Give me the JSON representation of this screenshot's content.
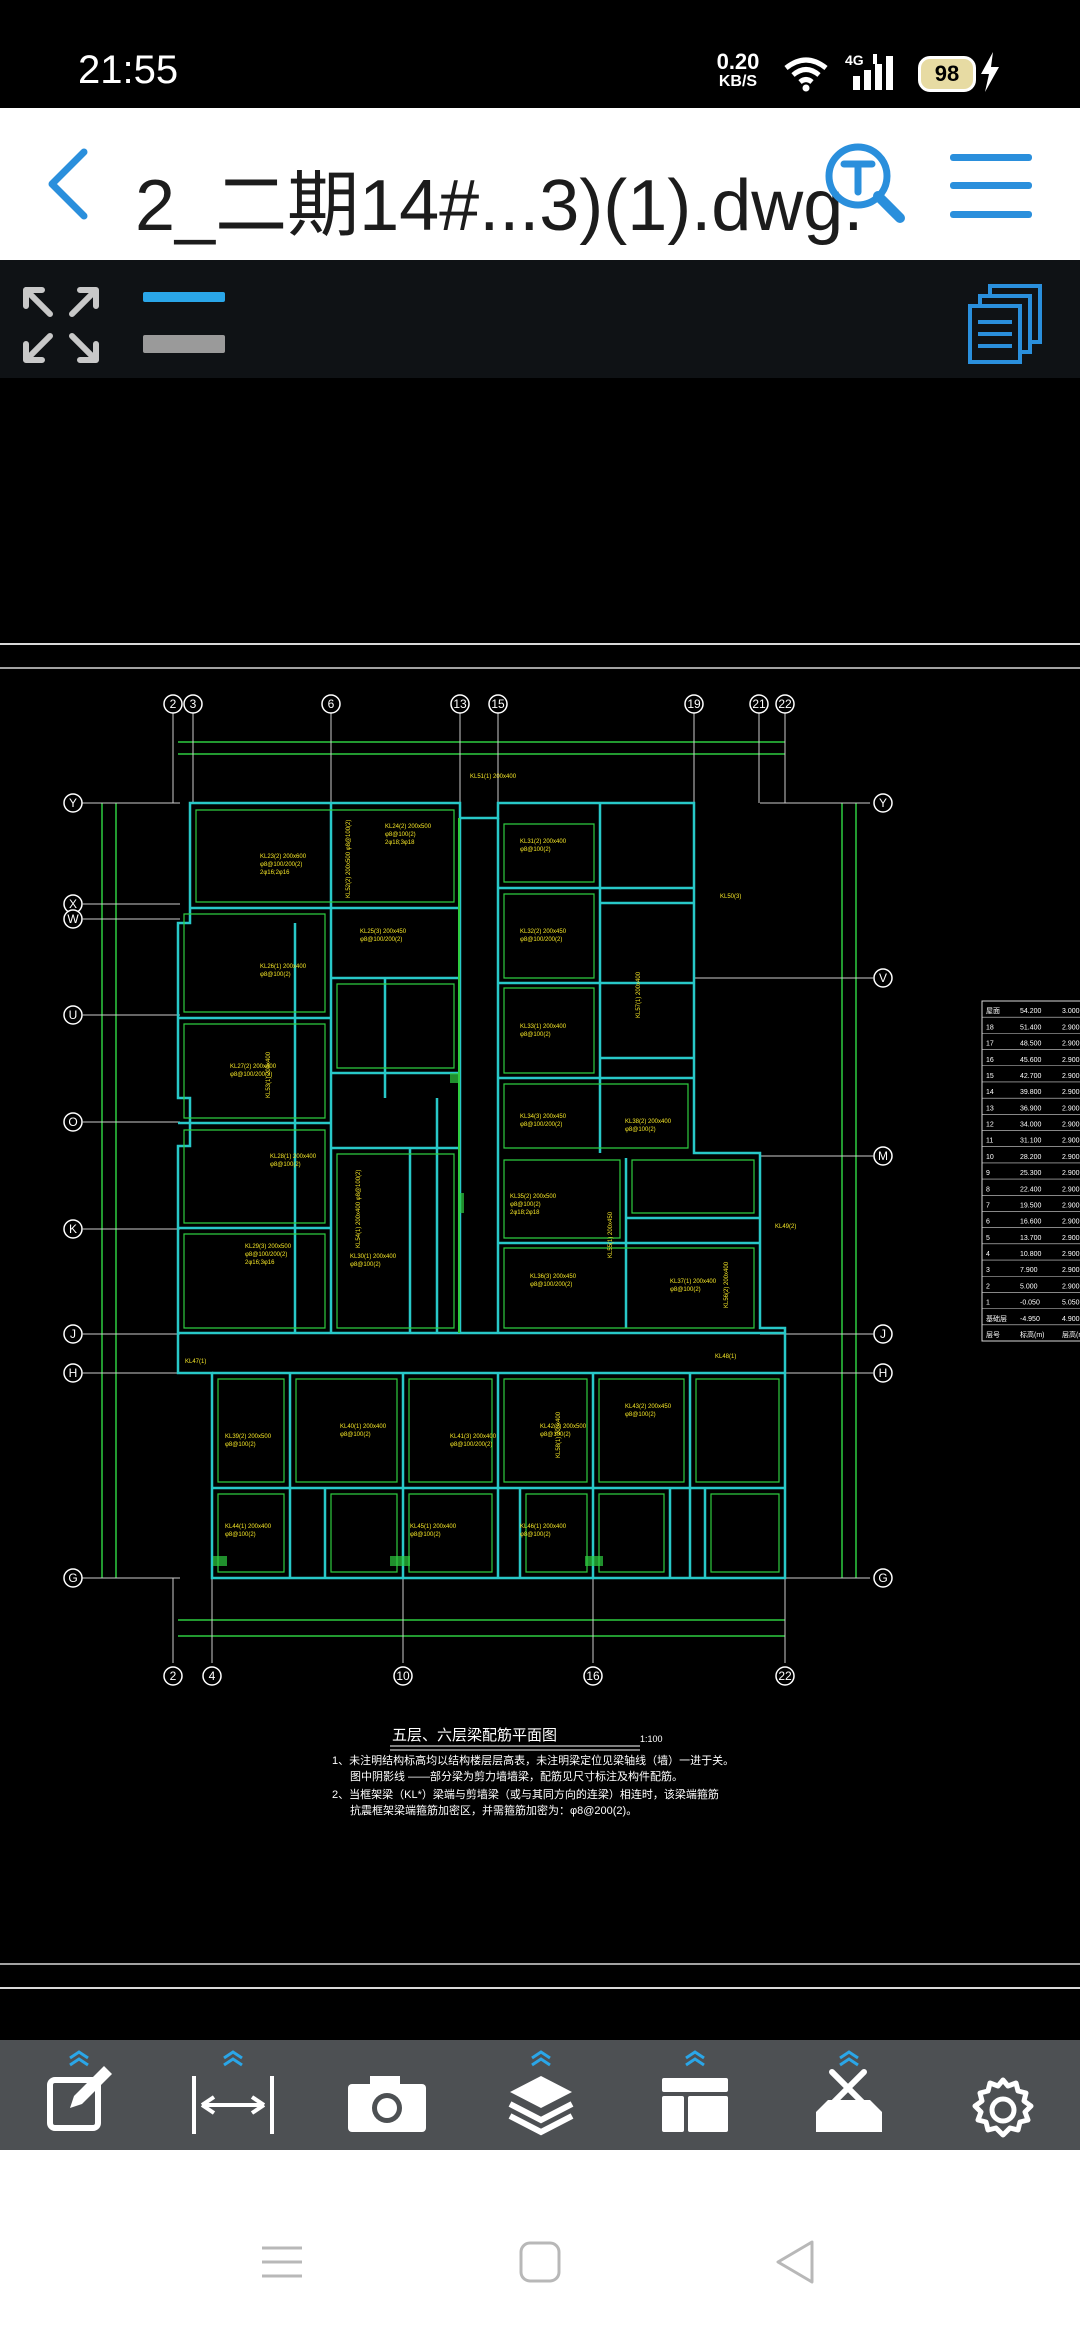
{
  "status": {
    "time": "21:55",
    "net_speed": "0.20",
    "net_unit": "KB/S",
    "network": "4G",
    "battery": "98"
  },
  "header": {
    "title": "2_二期14#...3)(1).dwg."
  },
  "drawing": {
    "title": "五层、六层梁配筋平面图",
    "scale": "1:100",
    "notes": [
      "1、未注明结构标高均以结构楼层层高表，未注明梁定位见梁轴线（墙）一进于关。",
      "图中阴影线    ——部分梁为剪力墙墙梁，配筋见尺寸标注及构件配筋。",
      "2、当框架梁（KL*）梁端与剪墙梁（或与其同方向的连梁）相连时，该梁端箍筋",
      "抗震框架梁端箍筋加密区，并需箍筋加密为：φ8@200(2)。"
    ],
    "grid_top": [
      "2",
      "3",
      "6",
      "13",
      "15",
      "19",
      "21",
      "22"
    ],
    "grid_bottom": [
      "2",
      "4",
      "10",
      "16",
      "22"
    ],
    "grid_left": [
      "Y",
      "X",
      "W",
      "U",
      "O",
      "K",
      "J",
      "H",
      "G"
    ],
    "grid_right": [
      "Y",
      "V",
      "M",
      "J",
      "H",
      "G"
    ],
    "level_table": {
      "rows": [
        [
          "屋面",
          "54.200",
          "3.000"
        ],
        [
          "18",
          "51.400",
          "2.900"
        ],
        [
          "17",
          "48.500",
          "2.900"
        ],
        [
          "16",
          "45.600",
          "2.900"
        ],
        [
          "15",
          "42.700",
          "2.900"
        ],
        [
          "14",
          "39.800",
          "2.900"
        ],
        [
          "13",
          "36.900",
          "2.900"
        ],
        [
          "12",
          "34.000",
          "2.900"
        ],
        [
          "11",
          "31.100",
          "2.900"
        ],
        [
          "10",
          "28.200",
          "2.900"
        ],
        [
          "9",
          "25.300",
          "2.900"
        ],
        [
          "8",
          "22.400",
          "2.900"
        ],
        [
          "7",
          "19.500",
          "2.900"
        ],
        [
          "6",
          "16.600",
          "2.900"
        ],
        [
          "5",
          "13.700",
          "2.900"
        ],
        [
          "4",
          "10.800",
          "2.900"
        ],
        [
          "3",
          "7.900",
          "2.900"
        ],
        [
          "2",
          "5.000",
          "2.900"
        ],
        [
          "1",
          "-0.050",
          "5.050"
        ],
        [
          "基础层",
          "-4.950",
          "4.900"
        ],
        [
          "层号",
          "标高(m)",
          "层高(m)"
        ]
      ]
    }
  },
  "icons": {
    "back": "chevron-left-icon",
    "search": "text-search-icon",
    "menu": "hamburger-menu-icon",
    "fullscreen": "expand-arrows-icon",
    "layout": "stacked-pages-icon"
  },
  "tools": [
    {
      "name": "edit-tool",
      "icon": "pencil-edit-icon"
    },
    {
      "name": "measure-tool",
      "icon": "dimension-measure-icon"
    },
    {
      "name": "screenshot-tool",
      "icon": "camera-icon"
    },
    {
      "name": "layers-tool",
      "icon": "layers-icon"
    },
    {
      "name": "layout-tool",
      "icon": "panel-layout-icon"
    },
    {
      "name": "toolbox-tool",
      "icon": "toolbox-icon"
    },
    {
      "name": "settings-tool",
      "icon": "gear-icon"
    }
  ],
  "colors": {
    "accent": "#2aa6e8",
    "cad_wall": "#28c8c8",
    "cad_beam": "#2ecc40",
    "cad_text": "#f5e626",
    "toolbar_dark": "#0f1215",
    "tools_bar": "#4d5053"
  }
}
